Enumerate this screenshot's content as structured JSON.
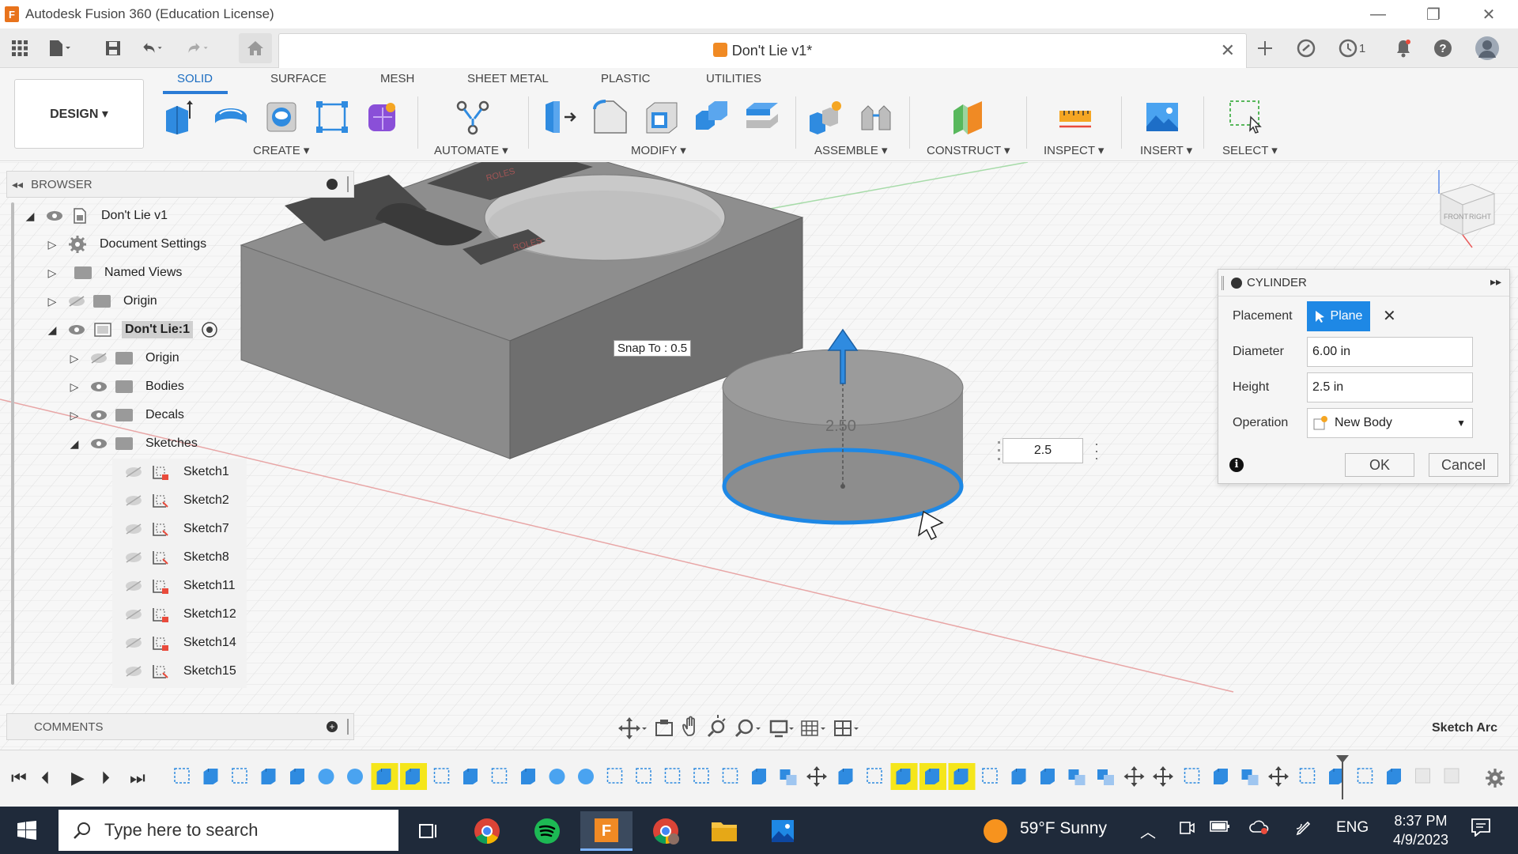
{
  "window": {
    "title": "Autodesk Fusion 360 (Education License)",
    "minimize": "—",
    "restore": "❐",
    "close": "✕"
  },
  "quick_access": {
    "doc_title": "Don't Lie v1*",
    "jobs_count": "1"
  },
  "ribbon": {
    "tabs": [
      "SOLID",
      "SURFACE",
      "MESH",
      "SHEET METAL",
      "PLASTIC",
      "UTILITIES"
    ],
    "workspace": "DESIGN ▾",
    "groups": [
      "CREATE ▾",
      "AUTOMATE ▾",
      "MODIFY ▾",
      "ASSEMBLE ▾",
      "CONSTRUCT ▾",
      "INSPECT ▾",
      "INSERT ▾",
      "SELECT ▾"
    ]
  },
  "browser": {
    "header": "BROWSER",
    "root": "Don't Lie v1",
    "items": [
      {
        "label": "Document Settings"
      },
      {
        "label": "Named Views"
      },
      {
        "label": "Origin"
      },
      {
        "label": "Don't Lie:1"
      },
      {
        "label": "Origin"
      },
      {
        "label": "Bodies"
      },
      {
        "label": "Decals"
      },
      {
        "label": "Sketches"
      }
    ],
    "sketches": [
      "Sketch1",
      "Sketch2",
      "Sketch7",
      "Sketch8",
      "Sketch11",
      "Sketch12",
      "Sketch14",
      "Sketch15"
    ]
  },
  "comments": {
    "header": "COMMENTS"
  },
  "viewport": {
    "snap_tooltip": "Snap To : 0.5",
    "height_field": "2.5",
    "dim_label": "2.50",
    "decal_text": "ROLES",
    "viewcube_labels": [
      "FRONT",
      "RIGHT"
    ]
  },
  "cylinder_dialog": {
    "title": "CYLINDER",
    "placement_label": "Placement",
    "placement_value": "Plane",
    "diameter_label": "Diameter",
    "diameter_value": "6.00 in",
    "height_label": "Height",
    "height_value": "2.5 in",
    "operation_label": "Operation",
    "operation_value": "New Body",
    "ok": "OK",
    "cancel": "Cancel"
  },
  "status": {
    "sketch_arc": "Sketch Arc"
  },
  "taskbar": {
    "search_placeholder": "Type here to search",
    "weather": "59°F  Sunny",
    "language": "ENG",
    "time": "8:37 PM",
    "date": "4/9/2023"
  },
  "colors": {
    "accent": "#2a7bd5",
    "selection_blue": "#1e88e5",
    "highlight_yellow": "#f5e61b",
    "body_grey": "#8a8a8a"
  }
}
